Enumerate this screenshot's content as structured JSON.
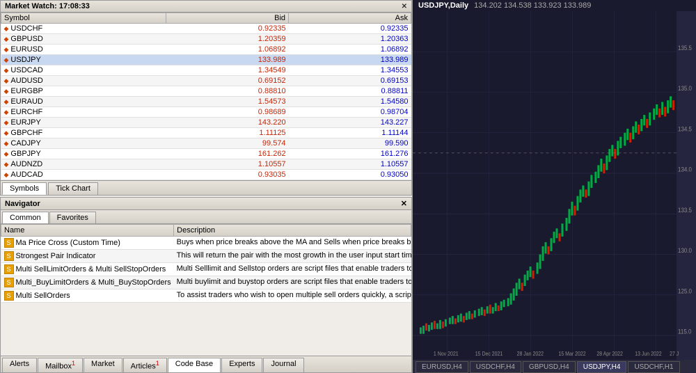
{
  "marketWatch": {
    "title": "Market Watch: 17:08:33",
    "columns": {
      "symbol": "Symbol",
      "bid": "Bid",
      "ask": "Ask"
    },
    "rows": [
      {
        "symbol": "USDCHF",
        "bid": "0.92335",
        "ask": "0.92335",
        "bidRed": true
      },
      {
        "symbol": "GBPUSD",
        "bid": "1.20359",
        "ask": "1.20363",
        "bidRed": true
      },
      {
        "symbol": "EURUSD",
        "bid": "1.06892",
        "ask": "1.06892",
        "bidRed": true
      },
      {
        "symbol": "USDJPY",
        "bid": "133.989",
        "ask": "133.989",
        "active": true,
        "bidRed": true
      },
      {
        "symbol": "USDCAD",
        "bid": "1.34549",
        "ask": "1.34553",
        "bidRed": true
      },
      {
        "symbol": "AUDUSD",
        "bid": "0.69152",
        "ask": "0.69153",
        "bidRed": true
      },
      {
        "symbol": "EURGBP",
        "bid": "0.88810",
        "ask": "0.88811",
        "bidRed": true
      },
      {
        "symbol": "EURAUD",
        "bid": "1.54573",
        "ask": "1.54580",
        "bidRed": true
      },
      {
        "symbol": "EURCHF",
        "bid": "0.98689",
        "ask": "0.98704",
        "bidRed": true
      },
      {
        "symbol": "EURJPY",
        "bid": "143.220",
        "ask": "143.227",
        "bidRed": true
      },
      {
        "symbol": "GBPCHF",
        "bid": "1.11125",
        "ask": "1.11144",
        "bidRed": true
      },
      {
        "symbol": "CADJPY",
        "bid": "99.574",
        "ask": "99.590",
        "bidRed": true
      },
      {
        "symbol": "GBPJPY",
        "bid": "161.262",
        "ask": "161.276",
        "bidRed": true
      },
      {
        "symbol": "AUDNZD",
        "bid": "1.10557",
        "ask": "1.10557",
        "bidRed": true
      },
      {
        "symbol": "AUDCAD",
        "bid": "0.93035",
        "ask": "0.93050",
        "bidRed": true
      }
    ],
    "tabs": [
      "Symbols",
      "Tick Chart"
    ]
  },
  "navigator": {
    "title": "Navigator",
    "tabs": [
      "Common",
      "Favorites"
    ],
    "activeTab": "Common",
    "columns": {
      "name": "Name",
      "description": "Description"
    },
    "rows": [
      {
        "name": "Ma Price Cross (Custom Time)",
        "description": "Buys when price breaks above the MA and Sells when price breaks below the MA. User can choose the time range (server time) to trade in."
      },
      {
        "name": "Strongest Pair Indicator",
        "description": "This will return the pair with the most growth in the user input start time and end time"
      },
      {
        "name": "Multi SellLimitOrders & Multi SellStopOrders",
        "description": "Multi Selllimit and Sellstop orders are script files that enable traders to place multiple orders with ease. These orders allow traders to enter the market a"
      },
      {
        "name": "Multi_BuyLimitOrders & Multi_BuyStopOrders",
        "description": "Multi buylimit and buystop orders are script files that enable traders to place multiple orders with ease. With just one command, traders can place multip"
      },
      {
        "name": "Multi SellOrders",
        "description": "To assist traders who wish to open multiple sell orders quickly, a script file has been developed that allows them to execute a large number of trades wi"
      }
    ]
  },
  "bottomTabs": {
    "tabs": [
      "Alerts",
      "Mailbox",
      "Market",
      "Articles",
      "Code Base",
      "Experts",
      "Journal"
    ],
    "activeTab": "Code Base",
    "badges": {
      "Mailbox": "1",
      "Articles": "1"
    }
  },
  "chart": {
    "title": "USDJPY,Daily",
    "ohlc": "134.202 134.538 133.923 133.989",
    "dates": [
      "1 Nov 2021",
      "15 Dec 2021",
      "28 Jan 2022",
      "15 Mar 2022",
      "28 Apr 2022",
      "13 Jun 2022",
      "27 J"
    ],
    "bottomTabs": [
      "EURUSD,H4",
      "USDCHF,H4",
      "GBPUSD,H4",
      "USDJPY,H4",
      "USDCHF,H1"
    ]
  }
}
